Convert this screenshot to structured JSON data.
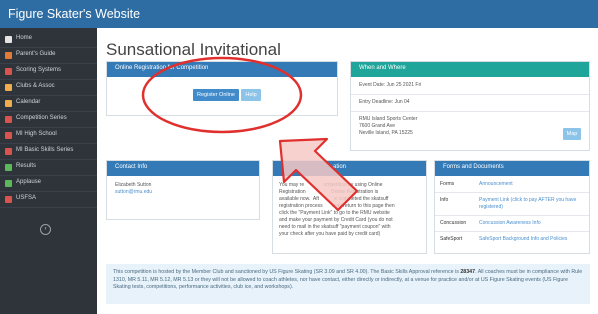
{
  "header": {
    "site_title": "Figure Skater's Website"
  },
  "sidebar": {
    "items": [
      {
        "label": "Home",
        "icon": "home-icon",
        "color": "#e4e4e4"
      },
      {
        "label": "Parent's Guide",
        "icon": "book-icon",
        "color": "#e07b39"
      },
      {
        "label": "Scoring Systems",
        "icon": "list-icon",
        "color": "#d9534f"
      },
      {
        "label": "Clubs & Assoc",
        "icon": "group-icon",
        "color": "#f0ad4e"
      },
      {
        "label": "Calendar",
        "icon": "calendar-icon",
        "color": "#f0ad4e"
      },
      {
        "label": "Competition Series",
        "icon": "grid-icon",
        "color": "#d9534f"
      },
      {
        "label": "MI High School",
        "icon": "grid-icon",
        "color": "#d9534f"
      },
      {
        "label": "MI Basic Skills Series",
        "icon": "grid-icon",
        "color": "#d9534f"
      },
      {
        "label": "Results",
        "icon": "trophy-icon",
        "color": "#5cb85c"
      },
      {
        "label": "Applause",
        "icon": "thumbs-up-icon",
        "color": "#5cb85c"
      },
      {
        "label": "USFSA",
        "icon": "skater-icon",
        "color": "#d9534f"
      }
    ],
    "toggle": "‹"
  },
  "main": {
    "title": "Sunsational Invitational",
    "registration": {
      "heading": "Online Registration for Competition",
      "register_label": "Register Online",
      "help_label": "Help"
    },
    "when_where": {
      "heading": "When and Where",
      "event_date": "Event Date: Jun 25 2021 Fri",
      "entry_deadline": "Entry Deadline: Jun 04",
      "venue_lines": [
        "RMU Island Sports Center",
        "7600 Grand Ave",
        "Neville Island, PA 15225"
      ],
      "map_label": "Map"
    },
    "contact": {
      "heading": "Contact Info",
      "name": "Elizabeth Sutton",
      "email": "sutton@rmu.edu"
    },
    "registration_info": {
      "heading_visible": "ation",
      "lines": [
        "You may re              ompetition by using Online",
        "Registration                  Online Registration is",
        "available now.  Aft           e completed the skatsuff",
        "registration process       may return to this page then",
        "click the \"Payment Link\" to go to the RMU website",
        "and make your payment by Credit Card (you do not",
        "need to mail in the skatsuff \"payment coupon\" with",
        "your check after you have paid by credit card)"
      ]
    },
    "forms": {
      "heading": "Forms and Documents",
      "rows": [
        {
          "label": "Forms",
          "value": "Announcement"
        },
        {
          "label": "Info",
          "value": "Payment Link (click to pay AFTER you have registered)"
        },
        {
          "label": "Concussion",
          "value": "Concussion Awareness Info"
        },
        {
          "label": "SafeSport",
          "value": "SafeSport Background Info and Policies"
        }
      ]
    },
    "notice": {
      "before_ref": "This competition is hosted by the Member Club and sanctioned by US Figure Skating (SR 3.09 and SR 4.00). The Basic Skills Approval reference is ",
      "ref_number": "28347",
      "after_ref": ". All coaches must be in compliance with Rule 1310, MR 5.11, MR 5.12, MR 5.13 or they will not be allowed to coach athletes, nor have contact, either directly or indirectly, at a venue for practice and/or at US Figure Skating events (US Figure Skating tests, competitions, performance activities, club ice, and workshops)."
    }
  },
  "colors": {
    "header_bar": "#2e6da4",
    "sidebar_bg": "#2f343b",
    "panel_blue": "#337ab7",
    "panel_teal": "#1fa59a",
    "button_blue": "#428bca",
    "button_light": "#8cc3e8",
    "annotation_red": "#e0302e",
    "arrow_fill": "#f4c9c5"
  }
}
